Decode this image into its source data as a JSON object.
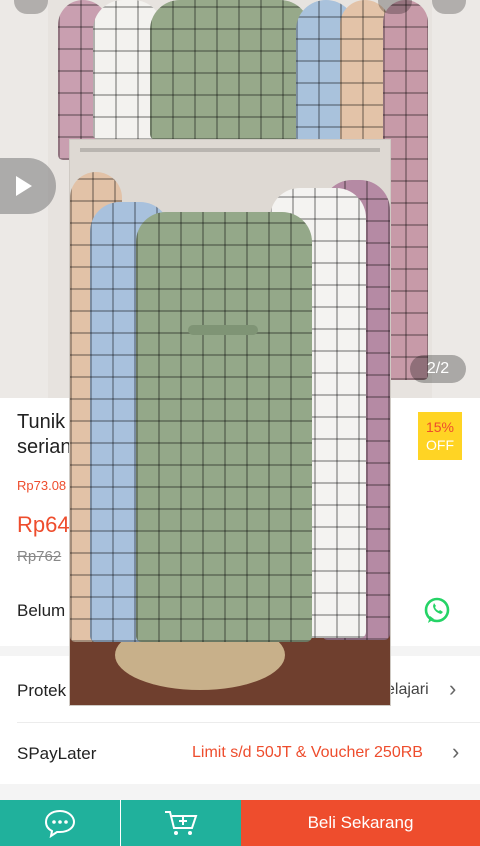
{
  "product": {
    "title_line1": "Tunik",
    "title_line2": "serian",
    "price_range_small": "Rp73.08",
    "price_current": "Rp64",
    "price_original": "Rp762",
    "discount_percent": "15%",
    "discount_off": "OFF"
  },
  "gallery": {
    "counter": "2/2"
  },
  "rows": {
    "row1_label": "Belum",
    "protection_label": "Protek",
    "protection_link": "elajari",
    "spaylater_label": "SPayLater",
    "spaylater_offer": "Limit s/d 50JT & Voucher 250RB"
  },
  "bottom_bar": {
    "buy_label": "Beli Sekarang"
  },
  "colors": {
    "brand_orange": "#ee4d2d",
    "teal": "#20b19c",
    "badge_yellow": "#ffd424",
    "whatsapp_green": "#25d366"
  },
  "icons": {
    "play": "play-icon",
    "chat": "chat-icon",
    "cart": "add-to-cart-icon",
    "whatsapp": "whatsapp-icon"
  }
}
